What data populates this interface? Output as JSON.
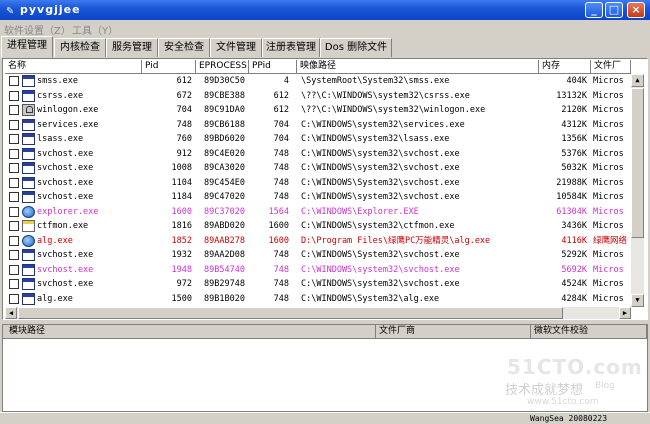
{
  "window": {
    "title": "pyvgjjee",
    "min": "_",
    "max": "□",
    "close": "×"
  },
  "menu": [
    "软件设置（Z）",
    "工具（Y）"
  ],
  "tabs": [
    "进程管理",
    "内核检查",
    "服务管理",
    "安全检查",
    "文件管理",
    "注册表管理",
    "Dos 删除文件"
  ],
  "columns": [
    "名称",
    "Pid",
    "EPROCESS",
    "PPid",
    "映像路径",
    "内存",
    "文件厂"
  ],
  "processes": [
    {
      "name": "smss.exe",
      "pid": "612",
      "eprocess": "89D30C50",
      "ppid": "4",
      "path": "\\SystemRoot\\System32\\smss.exe",
      "mem": "404K",
      "vendor": "Micros",
      "color": "#000000",
      "icon": "window"
    },
    {
      "name": "csrss.exe",
      "pid": "672",
      "eprocess": "89CBE388",
      "ppid": "612",
      "path": "\\??\\C:\\WINDOWS\\system32\\csrss.exe",
      "mem": "13132K",
      "vendor": "Micros",
      "color": "#000000",
      "icon": "window"
    },
    {
      "name": "winlogon.exe",
      "pid": "704",
      "eprocess": "89C91DA0",
      "ppid": "612",
      "path": "\\??\\C:\\WINDOWS\\system32\\winlogon.exe",
      "mem": "2120K",
      "vendor": "Micros",
      "color": "#000000",
      "icon": "lock"
    },
    {
      "name": "services.exe",
      "pid": "748",
      "eprocess": "89CB6188",
      "ppid": "704",
      "path": "C:\\WINDOWS\\system32\\services.exe",
      "mem": "4312K",
      "vendor": "Micros",
      "color": "#000000",
      "icon": "window"
    },
    {
      "name": "lsass.exe",
      "pid": "760",
      "eprocess": "89BD6020",
      "ppid": "704",
      "path": "C:\\WINDOWS\\system32\\lsass.exe",
      "mem": "1356K",
      "vendor": "Micros",
      "color": "#000000",
      "icon": "window"
    },
    {
      "name": "svchost.exe",
      "pid": "912",
      "eprocess": "89C4E020",
      "ppid": "748",
      "path": "C:\\WINDOWS\\system32\\svchost.exe",
      "mem": "5376K",
      "vendor": "Micros",
      "color": "#000000",
      "icon": "window"
    },
    {
      "name": "svchost.exe",
      "pid": "1008",
      "eprocess": "89CA3020",
      "ppid": "748",
      "path": "C:\\WINDOWS\\system32\\svchost.exe",
      "mem": "5032K",
      "vendor": "Micros",
      "color": "#000000",
      "icon": "window"
    },
    {
      "name": "svchost.exe",
      "pid": "1104",
      "eprocess": "89C454E0",
      "ppid": "748",
      "path": "C:\\WINDOWS\\System32\\svchost.exe",
      "mem": "21988K",
      "vendor": "Micros",
      "color": "#000000",
      "icon": "window"
    },
    {
      "name": "svchost.exe",
      "pid": "1184",
      "eprocess": "89C47020",
      "ppid": "748",
      "path": "C:\\WINDOWS\\system32\\svchost.exe",
      "mem": "10584K",
      "vendor": "Micros",
      "color": "#000000",
      "icon": "window"
    },
    {
      "name": "explorer.exe",
      "pid": "1600",
      "eprocess": "89C37020",
      "ppid": "1564",
      "path": "C:\\WINDOWS\\Explorer.EXE",
      "mem": "61304K",
      "vendor": "Micros",
      "color": "#cc33cc",
      "icon": "web"
    },
    {
      "name": "ctfmon.exe",
      "pid": "1816",
      "eprocess": "89ABD020",
      "ppid": "1600",
      "path": "C:\\WINDOWS\\system32\\ctfmon.exe",
      "mem": "3436K",
      "vendor": "Micros",
      "color": "#000000",
      "icon": "ctf"
    },
    {
      "name": "alg.exe",
      "pid": "1852",
      "eprocess": "89AAB278",
      "ppid": "1600",
      "path": "D:\\Program Files\\绿鹰PC万能精灵\\alg.exe",
      "mem": "4116K",
      "vendor": "绿鹰网络",
      "color": "#cc0000",
      "icon": "web"
    },
    {
      "name": "svchost.exe",
      "pid": "1932",
      "eprocess": "89AA2D08",
      "ppid": "748",
      "path": "C:\\WINDOWS\\System32\\svchost.exe",
      "mem": "5292K",
      "vendor": "Micros",
      "color": "#000000",
      "icon": "window"
    },
    {
      "name": "svchost.exe",
      "pid": "1948",
      "eprocess": "89B54740",
      "ppid": "748",
      "path": "C:\\WINDOWS\\system32\\svchost.exe",
      "mem": "5692K",
      "vendor": "Micros",
      "color": "#cc33cc",
      "icon": "window"
    },
    {
      "name": "svchost.exe",
      "pid": "972",
      "eprocess": "89B29748",
      "ppid": "748",
      "path": "C:\\WINDOWS\\system32\\svchost.exe",
      "mem": "4524K",
      "vendor": "Micros",
      "color": "#000000",
      "icon": "window"
    },
    {
      "name": "alg.exe",
      "pid": "1500",
      "eprocess": "89B1B020",
      "ppid": "748",
      "path": "C:\\WINDOWS\\System32\\alg.exe",
      "mem": "4284K",
      "vendor": "Micros",
      "color": "#000000",
      "icon": "window"
    }
  ],
  "modules_columns": [
    "模块路径",
    "文件厂商",
    "微软文件校验"
  ],
  "status": "WangSea 20080223",
  "watermark": {
    "logo": "51CTO.com",
    "slogan": "技术成就梦想",
    "blog": "Blog",
    "url": "www.51cto.com"
  }
}
